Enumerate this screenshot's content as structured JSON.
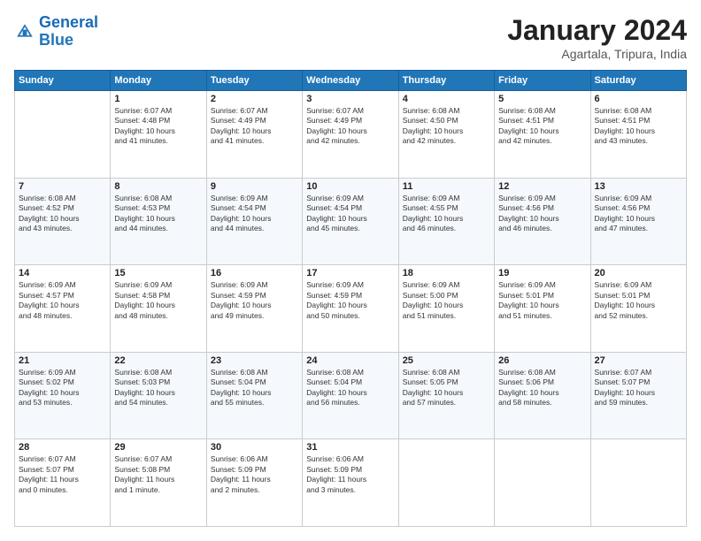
{
  "logo": {
    "line1": "General",
    "line2": "Blue"
  },
  "title": "January 2024",
  "subtitle": "Agartala, Tripura, India",
  "weekdays": [
    "Sunday",
    "Monday",
    "Tuesday",
    "Wednesday",
    "Thursday",
    "Friday",
    "Saturday"
  ],
  "weeks": [
    [
      {
        "day": "",
        "info": ""
      },
      {
        "day": "1",
        "info": "Sunrise: 6:07 AM\nSunset: 4:48 PM\nDaylight: 10 hours\nand 41 minutes."
      },
      {
        "day": "2",
        "info": "Sunrise: 6:07 AM\nSunset: 4:49 PM\nDaylight: 10 hours\nand 41 minutes."
      },
      {
        "day": "3",
        "info": "Sunrise: 6:07 AM\nSunset: 4:49 PM\nDaylight: 10 hours\nand 42 minutes."
      },
      {
        "day": "4",
        "info": "Sunrise: 6:08 AM\nSunset: 4:50 PM\nDaylight: 10 hours\nand 42 minutes."
      },
      {
        "day": "5",
        "info": "Sunrise: 6:08 AM\nSunset: 4:51 PM\nDaylight: 10 hours\nand 42 minutes."
      },
      {
        "day": "6",
        "info": "Sunrise: 6:08 AM\nSunset: 4:51 PM\nDaylight: 10 hours\nand 43 minutes."
      }
    ],
    [
      {
        "day": "7",
        "info": "Sunrise: 6:08 AM\nSunset: 4:52 PM\nDaylight: 10 hours\nand 43 minutes."
      },
      {
        "day": "8",
        "info": "Sunrise: 6:08 AM\nSunset: 4:53 PM\nDaylight: 10 hours\nand 44 minutes."
      },
      {
        "day": "9",
        "info": "Sunrise: 6:09 AM\nSunset: 4:54 PM\nDaylight: 10 hours\nand 44 minutes."
      },
      {
        "day": "10",
        "info": "Sunrise: 6:09 AM\nSunset: 4:54 PM\nDaylight: 10 hours\nand 45 minutes."
      },
      {
        "day": "11",
        "info": "Sunrise: 6:09 AM\nSunset: 4:55 PM\nDaylight: 10 hours\nand 46 minutes."
      },
      {
        "day": "12",
        "info": "Sunrise: 6:09 AM\nSunset: 4:56 PM\nDaylight: 10 hours\nand 46 minutes."
      },
      {
        "day": "13",
        "info": "Sunrise: 6:09 AM\nSunset: 4:56 PM\nDaylight: 10 hours\nand 47 minutes."
      }
    ],
    [
      {
        "day": "14",
        "info": "Sunrise: 6:09 AM\nSunset: 4:57 PM\nDaylight: 10 hours\nand 48 minutes."
      },
      {
        "day": "15",
        "info": "Sunrise: 6:09 AM\nSunset: 4:58 PM\nDaylight: 10 hours\nand 48 minutes."
      },
      {
        "day": "16",
        "info": "Sunrise: 6:09 AM\nSunset: 4:59 PM\nDaylight: 10 hours\nand 49 minutes."
      },
      {
        "day": "17",
        "info": "Sunrise: 6:09 AM\nSunset: 4:59 PM\nDaylight: 10 hours\nand 50 minutes."
      },
      {
        "day": "18",
        "info": "Sunrise: 6:09 AM\nSunset: 5:00 PM\nDaylight: 10 hours\nand 51 minutes."
      },
      {
        "day": "19",
        "info": "Sunrise: 6:09 AM\nSunset: 5:01 PM\nDaylight: 10 hours\nand 51 minutes."
      },
      {
        "day": "20",
        "info": "Sunrise: 6:09 AM\nSunset: 5:01 PM\nDaylight: 10 hours\nand 52 minutes."
      }
    ],
    [
      {
        "day": "21",
        "info": "Sunrise: 6:09 AM\nSunset: 5:02 PM\nDaylight: 10 hours\nand 53 minutes."
      },
      {
        "day": "22",
        "info": "Sunrise: 6:08 AM\nSunset: 5:03 PM\nDaylight: 10 hours\nand 54 minutes."
      },
      {
        "day": "23",
        "info": "Sunrise: 6:08 AM\nSunset: 5:04 PM\nDaylight: 10 hours\nand 55 minutes."
      },
      {
        "day": "24",
        "info": "Sunrise: 6:08 AM\nSunset: 5:04 PM\nDaylight: 10 hours\nand 56 minutes."
      },
      {
        "day": "25",
        "info": "Sunrise: 6:08 AM\nSunset: 5:05 PM\nDaylight: 10 hours\nand 57 minutes."
      },
      {
        "day": "26",
        "info": "Sunrise: 6:08 AM\nSunset: 5:06 PM\nDaylight: 10 hours\nand 58 minutes."
      },
      {
        "day": "27",
        "info": "Sunrise: 6:07 AM\nSunset: 5:07 PM\nDaylight: 10 hours\nand 59 minutes."
      }
    ],
    [
      {
        "day": "28",
        "info": "Sunrise: 6:07 AM\nSunset: 5:07 PM\nDaylight: 11 hours\nand 0 minutes."
      },
      {
        "day": "29",
        "info": "Sunrise: 6:07 AM\nSunset: 5:08 PM\nDaylight: 11 hours\nand 1 minute."
      },
      {
        "day": "30",
        "info": "Sunrise: 6:06 AM\nSunset: 5:09 PM\nDaylight: 11 hours\nand 2 minutes."
      },
      {
        "day": "31",
        "info": "Sunrise: 6:06 AM\nSunset: 5:09 PM\nDaylight: 11 hours\nand 3 minutes."
      },
      {
        "day": "",
        "info": ""
      },
      {
        "day": "",
        "info": ""
      },
      {
        "day": "",
        "info": ""
      }
    ]
  ]
}
